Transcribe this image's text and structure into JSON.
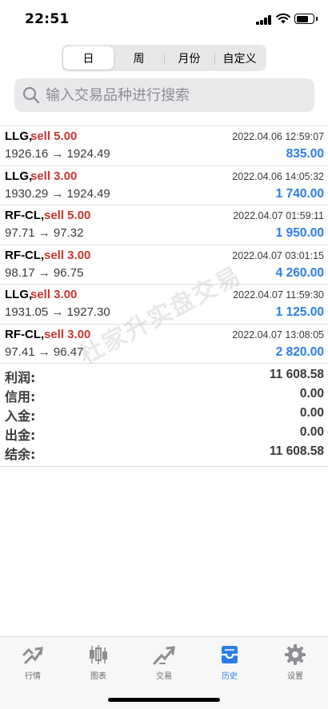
{
  "status_bar": {
    "time": "22:51"
  },
  "period_tabs": [
    {
      "label": "日",
      "active": true
    },
    {
      "label": "周",
      "active": false
    },
    {
      "label": "月份",
      "active": false
    },
    {
      "label": "自定义",
      "active": false
    }
  ],
  "search": {
    "placeholder": "输入交易品种进行搜索"
  },
  "deals": [
    {
      "symbol": "LLG,",
      "side": "sell 5.00",
      "time": "2022.04.06 12:59:07",
      "prices": "1926.16 → 1924.49",
      "profit": "835.00"
    },
    {
      "symbol": "LLG,",
      "side": "sell 3.00",
      "time": "2022.04.06 14:05:32",
      "prices": "1930.29 → 1924.49",
      "profit": "1 740.00"
    },
    {
      "symbol": "RF-CL,",
      "side": "sell 5.00",
      "time": "2022.04.07 01:59:11",
      "prices": "97.71 → 97.32",
      "profit": "1 950.00"
    },
    {
      "symbol": "RF-CL,",
      "side": "sell 3.00",
      "time": "2022.04.07 03:01:15",
      "prices": "98.17 → 96.75",
      "profit": "4 260.00"
    },
    {
      "symbol": "LLG,",
      "side": "sell 3.00",
      "time": "2022.04.07 11:59:30",
      "prices": "1931.05 → 1927.30",
      "profit": "1 125.00"
    },
    {
      "symbol": "RF-CL,",
      "side": "sell 3.00",
      "time": "2022.04.07 13:08:05",
      "prices": "97.41 → 96.47",
      "profit": "2 820.00"
    }
  ],
  "summary": [
    {
      "label": "利润:",
      "value": "11 608.58"
    },
    {
      "label": "信用:",
      "value": "0.00"
    },
    {
      "label": "入金:",
      "value": "0.00"
    },
    {
      "label": "出金:",
      "value": "0.00"
    },
    {
      "label": "结余:",
      "value": "11 608.58"
    }
  ],
  "watermark": "杜家升实盘交易",
  "tabbar": [
    {
      "label": "行情",
      "icon": "quotes-icon",
      "active": false
    },
    {
      "label": "图表",
      "icon": "chart-icon",
      "active": false
    },
    {
      "label": "交易",
      "icon": "trade-icon",
      "active": false
    },
    {
      "label": "历史",
      "icon": "history-icon",
      "active": true
    },
    {
      "label": "设置",
      "icon": "settings-icon",
      "active": false
    }
  ],
  "colors": {
    "sell": "#c8362e",
    "profit": "#2b7de9",
    "active_tab": "#2b7de9",
    "inactive_icon": "#8e8e93"
  }
}
